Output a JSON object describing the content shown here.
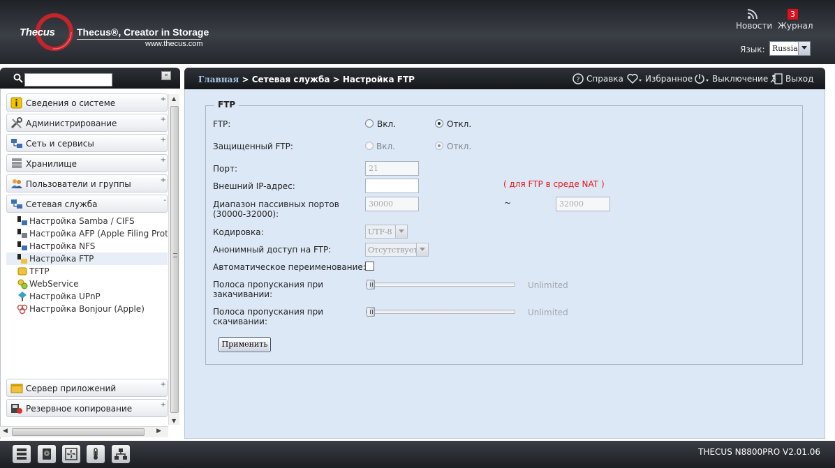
{
  "header": {
    "brand": "Thecus",
    "tagline": "Thecus®, Creator in Storage",
    "url": "www.thecus.com",
    "news_label": "Новости",
    "journal_label": "Журнал",
    "journal_badge": "3",
    "language_label": "Язык:",
    "language_value": "Russia"
  },
  "sidebar": {
    "search_placeholder": "",
    "collapse_label": "«",
    "categories": [
      {
        "label": "Сведения о системе",
        "icon": "info-icon"
      },
      {
        "label": "Администрирование",
        "icon": "tools-icon"
      },
      {
        "label": "Сеть и сервисы",
        "icon": "network-icon"
      },
      {
        "label": "Хранилище",
        "icon": "storage-icon"
      },
      {
        "label": "Пользователи и группы",
        "icon": "users-icon"
      },
      {
        "label": "Сетевая служба",
        "icon": "network-service-icon"
      }
    ],
    "sub_items": [
      {
        "label": "Настройка Samba / CIFS",
        "icon": "samba-icon"
      },
      {
        "label": "Настройка AFP (Apple Filing Protocol)",
        "icon": "afp-icon"
      },
      {
        "label": "Настройка NFS",
        "icon": "nfs-icon"
      },
      {
        "label": "Настройка FTP",
        "icon": "ftp-icon"
      },
      {
        "label": "TFTP",
        "icon": "tftp-icon"
      },
      {
        "label": "WebService",
        "icon": "webservice-icon"
      },
      {
        "label": "Настройка UPnP",
        "icon": "upnp-icon"
      },
      {
        "label": "Настройка Bonjour (Apple)",
        "icon": "bonjour-icon"
      }
    ],
    "bottom_categories": [
      {
        "label": "Сервер приложений",
        "icon": "app-server-icon"
      },
      {
        "label": "Резервное копирование",
        "icon": "backup-icon"
      }
    ],
    "expanded_marker": "-",
    "collapsed_marker": "+"
  },
  "toolbar": {
    "breadcrumb_home": "Главная",
    "breadcrumb_rest": " > Сетевая служба > Настройка FTP",
    "help": "Справка",
    "favorites": "Избранное",
    "shutdown": "Выключение",
    "logout": "Выход"
  },
  "ftp_form": {
    "legend": "FTP",
    "ftp_label": "FTP:",
    "ftp_on": "Вкл.",
    "ftp_off": "Откл.",
    "ftp_value": "off",
    "secure_label": "Защищенный FTP:",
    "secure_on": "Вкл.",
    "secure_off": "Откл.",
    "secure_value": "off",
    "port_label": "Порт:",
    "port_value": "21",
    "external_ip_label": "Внешний IP-адрес:",
    "external_ip_value": "",
    "nat_note": "( для FTP в среде NAT )",
    "passive_label_1": "Диапазон пассивных портов",
    "passive_label_2": "(30000-32000):",
    "passive_from": "30000",
    "passive_sep": "~",
    "passive_to": "32000",
    "encoding_label": "Кодировка:",
    "encoding_value": "UTF-8",
    "anon_label": "Анонимный доступ на FTP:",
    "anon_value": "Отсутствует",
    "auto_rename_label": "Автоматическое переименование:",
    "auto_rename_checked": false,
    "upload_bw_label_1": "Полоса пропускания при",
    "upload_bw_label_2": "закачивании:",
    "upload_bw_value": "Unlimited",
    "download_bw_label_1": "Полоса пропускания при",
    "download_bw_label_2": "скачивании:",
    "download_bw_value": "Unlimited",
    "apply_label": "Применить"
  },
  "footer": {
    "version": "THECUS N8800PRO V2.01.06",
    "buttons": [
      "server-status-icon",
      "disk-icon",
      "fan-icon",
      "temperature-icon",
      "network-topology-icon"
    ]
  },
  "colors": {
    "panel_bg": "#dde8f6",
    "header_bg": "#2e3238",
    "nat_note": "#e21a1a",
    "journal_badge": "#e0101a"
  }
}
